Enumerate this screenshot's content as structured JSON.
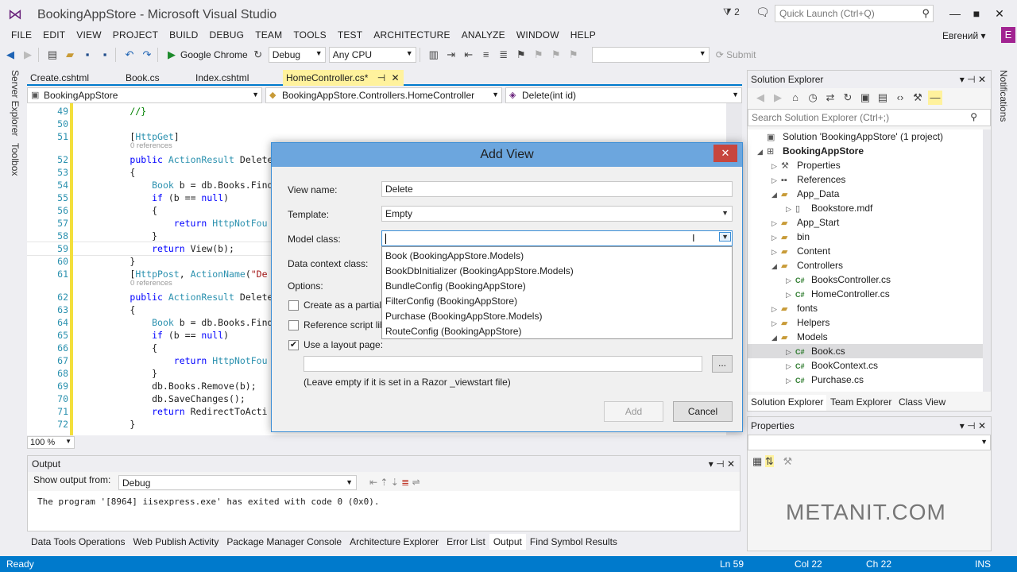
{
  "window": {
    "title": "BookingAppStore - Microsoft Visual Studio",
    "filter_count": "2",
    "quick_launch_placeholder": "Quick Launch (Ctrl+Q)",
    "user": "Евгений",
    "user_badge": "E"
  },
  "menu": [
    "FILE",
    "EDIT",
    "VIEW",
    "PROJECT",
    "BUILD",
    "DEBUG",
    "TEAM",
    "TOOLS",
    "TEST",
    "ARCHITECTURE",
    "ANALYZE",
    "WINDOW",
    "HELP"
  ],
  "toolbar": {
    "run_target": "Google Chrome",
    "configuration": "Debug",
    "platform": "Any CPU",
    "submit_label": "Submit"
  },
  "side_tabs": {
    "left": [
      "Server Explorer",
      "Toolbox"
    ],
    "right": [
      "Notifications"
    ]
  },
  "doc_tabs": [
    "Create.cshtml",
    "Book.cs",
    "Index.cshtml",
    "HomeController.cs*"
  ],
  "nav": {
    "project": "BookingAppStore",
    "class": "BookingAppStore.Controllers.HomeController",
    "member": "Delete(int id)"
  },
  "code_lines": [
    {
      "n": "49",
      "t": "        //}"
    },
    {
      "n": "50",
      "t": ""
    },
    {
      "n": "51",
      "t": "        [HttpGet]"
    },
    {
      "n": "52",
      "t": "        public ActionResult Delete"
    },
    {
      "n": "53",
      "t": "        {"
    },
    {
      "n": "54",
      "t": "            Book b = db.Books.Find"
    },
    {
      "n": "55",
      "t": "            if (b == null)"
    },
    {
      "n": "56",
      "t": "            {"
    },
    {
      "n": "57",
      "t": "                return HttpNotFou"
    },
    {
      "n": "58",
      "t": "            }"
    },
    {
      "n": "59",
      "t": "            return View(b);"
    },
    {
      "n": "60",
      "t": "        }"
    },
    {
      "n": "61",
      "t": "        [HttpPost, ActionName(\"De"
    },
    {
      "n": "62",
      "t": "        public ActionResult Delete"
    },
    {
      "n": "63",
      "t": "        {"
    },
    {
      "n": "64",
      "t": "            Book b = db.Books.Find"
    },
    {
      "n": "65",
      "t": "            if (b == null)"
    },
    {
      "n": "66",
      "t": "            {"
    },
    {
      "n": "67",
      "t": "                return HttpNotFou"
    },
    {
      "n": "68",
      "t": "            }"
    },
    {
      "n": "69",
      "t": "            db.Books.Remove(b);"
    },
    {
      "n": "70",
      "t": "            db.SaveChanges();"
    },
    {
      "n": "71",
      "t": "            return RedirectToActi"
    },
    {
      "n": "72",
      "t": "        }"
    }
  ],
  "references_label": "0 references",
  "zoom": "100 %",
  "output": {
    "title": "Output",
    "show_from_label": "Show output from:",
    "source": "Debug",
    "line": "The program '[8964] iisexpress.exe' has exited with code 0 (0x0)."
  },
  "bottom_tabs": [
    "Data Tools Operations",
    "Web Publish Activity",
    "Package Manager Console",
    "Architecture Explorer",
    "Error List",
    "Output",
    "Find Symbol Results"
  ],
  "status": {
    "ready": "Ready",
    "ln": "Ln 59",
    "col": "Col 22",
    "ch": "Ch 22",
    "mode": "INS"
  },
  "solution_explorer": {
    "title": "Solution Explorer",
    "search_placeholder": "Search Solution Explorer (Ctrl+;)",
    "tree": [
      {
        "label": "Solution 'BookingAppStore' (1 project)",
        "depth": 0,
        "exp": "",
        "icon": "solution-icon"
      },
      {
        "label": "BookingAppStore",
        "depth": 0,
        "exp": "◢",
        "icon": "project-icon",
        "bold": true
      },
      {
        "label": "Properties",
        "depth": 1,
        "exp": "▷",
        "icon": "wrench-icon"
      },
      {
        "label": "References",
        "depth": 1,
        "exp": "▷",
        "icon": "references-icon"
      },
      {
        "label": "App_Data",
        "depth": 1,
        "exp": "◢",
        "icon": "folder-icon"
      },
      {
        "label": "Bookstore.mdf",
        "depth": 2,
        "exp": "▷",
        "icon": "file-icon"
      },
      {
        "label": "App_Start",
        "depth": 1,
        "exp": "▷",
        "icon": "folder-icon"
      },
      {
        "label": "bin",
        "depth": 1,
        "exp": "▷",
        "icon": "folder-icon"
      },
      {
        "label": "Content",
        "depth": 1,
        "exp": "▷",
        "icon": "folder-icon"
      },
      {
        "label": "Controllers",
        "depth": 1,
        "exp": "◢",
        "icon": "folder-icon"
      },
      {
        "label": "BooksController.cs",
        "depth": 2,
        "exp": "▷",
        "icon": "csharp-icon"
      },
      {
        "label": "HomeController.cs",
        "depth": 2,
        "exp": "▷",
        "icon": "csharp-icon"
      },
      {
        "label": "fonts",
        "depth": 1,
        "exp": "▷",
        "icon": "folder-icon"
      },
      {
        "label": "Helpers",
        "depth": 1,
        "exp": "▷",
        "icon": "folder-icon"
      },
      {
        "label": "Models",
        "depth": 1,
        "exp": "◢",
        "icon": "folder-icon"
      },
      {
        "label": "Book.cs",
        "depth": 2,
        "exp": "▷",
        "icon": "csharp-icon",
        "selected": true
      },
      {
        "label": "BookContext.cs",
        "depth": 2,
        "exp": "▷",
        "icon": "csharp-icon"
      },
      {
        "label": "Purchase.cs",
        "depth": 2,
        "exp": "▷",
        "icon": "csharp-icon"
      }
    ],
    "tabs": [
      "Solution Explorer",
      "Team Explorer",
      "Class View"
    ]
  },
  "properties": {
    "title": "Properties"
  },
  "watermark": "METANIT.COM",
  "dialog": {
    "title": "Add View",
    "view_name_label": "View name:",
    "view_name_value": "Delete",
    "template_label": "Template:",
    "template_value": "Empty",
    "model_class_label": "Model class:",
    "model_class_value": "",
    "data_context_label": "Data context class:",
    "options_label": "Options:",
    "partial_label": "Create as a partial",
    "script_label": "Reference script lib",
    "layout_label": "Use a layout page:",
    "layout_value": "",
    "browse_label": "...",
    "hint": "(Leave empty if it is set in a Razor _viewstart file)",
    "add_label": "Add",
    "cancel_label": "Cancel",
    "model_options": [
      "Book (BookingAppStore.Models)",
      "BookDbInitializer (BookingAppStore.Models)",
      "BundleConfig (BookingAppStore)",
      "FilterConfig (BookingAppStore)",
      "Purchase (BookingAppStore.Models)",
      "RouteConfig (BookingAppStore)"
    ]
  }
}
